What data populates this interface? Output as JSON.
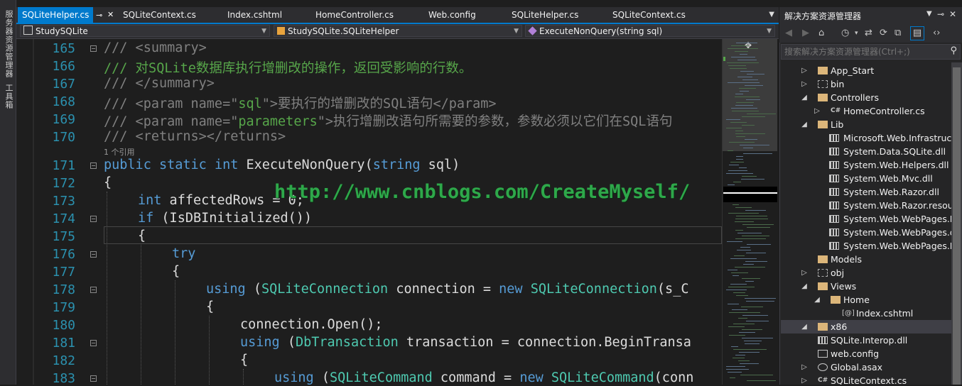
{
  "side_strip": {
    "server_explorer": "服务器资源管理器",
    "toolbox": "工具箱"
  },
  "tabs": [
    {
      "label": "SQLiteHelper.cs",
      "active": true
    },
    {
      "label": "SQLiteContext.cs"
    },
    {
      "label": "Index.cshtml"
    },
    {
      "label": "HomeController.cs"
    },
    {
      "label": "Web.config"
    },
    {
      "label": "SQLiteHelper.cs"
    },
    {
      "label": "SQLiteContext.cs"
    }
  ],
  "nav": {
    "project": "StudySQLite",
    "class": "StudySQLite.SQLiteHelper",
    "member": "ExecuteNonQuery(string sql)"
  },
  "editor": {
    "line_numbers": [
      "165",
      "166",
      "167",
      "168",
      "169",
      "170",
      "171",
      "172",
      "173",
      "174",
      "175",
      "176",
      "177",
      "178",
      "179",
      "180",
      "181",
      "182",
      "183"
    ],
    "codelens": "1 个引用",
    "watermark": "http://www.cnblogs.com/CreateMyself/",
    "lines": {
      "l165": [
        "/// <summary>"
      ],
      "l166": [
        "/// 对SQLite数据库执行增删改的操作，返回受影响的行数。"
      ],
      "l167": [
        "/// </summary>"
      ],
      "l168": [
        "/// <param name=\"",
        "sql",
        "\">要执行的增删改的SQL语句</param>"
      ],
      "l169": [
        "/// <param name=\"",
        "parameters",
        "\">执行增删改语句所需要的参数，参数必须以它们在SQL语句"
      ],
      "l170": [
        "/// <returns></returns>"
      ],
      "l171": [
        "public",
        " ",
        "static",
        " ",
        "int",
        " ExecuteNonQuery(",
        "string",
        " sql)"
      ],
      "l172": [
        "{"
      ],
      "l173": [
        "int",
        " affectedRows = 0;"
      ],
      "l174": [
        "if",
        " (IsDBInitialized())"
      ],
      "l175": [
        "{"
      ],
      "l176": [
        "try"
      ],
      "l177": [
        "{"
      ],
      "l178": [
        "using",
        " (",
        "SQLiteConnection",
        " connection = ",
        "new",
        " ",
        "SQLiteConnection",
        "(s_C"
      ],
      "l179": [
        "{"
      ],
      "l180": [
        "connection.Open();"
      ],
      "l181": [
        "using",
        " (",
        "DbTransaction",
        " transaction = connection.BeginTransa"
      ],
      "l182": [
        "{"
      ],
      "l183": [
        "using",
        " (",
        "SQLiteCommand",
        " command = ",
        "new",
        " ",
        "SQLiteCommand",
        "(conn"
      ]
    }
  },
  "solution_explorer": {
    "title": "解决方案资源管理器",
    "search_placeholder": "搜索解决方案资源管理器(Ctrl+;)",
    "items": [
      {
        "label": "App_Start"
      },
      {
        "label": "bin"
      },
      {
        "label": "Controllers"
      },
      {
        "label": "HomeController.cs"
      },
      {
        "label": "Lib"
      },
      {
        "label": "Microsoft.Web.Infrastructu"
      },
      {
        "label": "System.Data.SQLite.dll"
      },
      {
        "label": "System.Web.Helpers.dll"
      },
      {
        "label": "System.Web.Mvc.dll"
      },
      {
        "label": "System.Web.Razor.dll"
      },
      {
        "label": "System.Web.Razor.resourc"
      },
      {
        "label": "System.Web.WebPages.De"
      },
      {
        "label": "System.Web.WebPages.dl"
      },
      {
        "label": "System.Web.WebPages.Ra"
      },
      {
        "label": "Models"
      },
      {
        "label": "obj"
      },
      {
        "label": "Views"
      },
      {
        "label": "Home"
      },
      {
        "label": "Index.cshtml"
      },
      {
        "label": "x86",
        "selected": true
      },
      {
        "label": "SQLite.Interop.dll"
      },
      {
        "label": "web.config"
      },
      {
        "label": "Global.asax"
      },
      {
        "label": "SQLiteContext.cs"
      }
    ]
  },
  "colors": {
    "accent": "#007acc",
    "comment": "#57a64a",
    "keyword": "#569cd6",
    "type": "#4ec9b0",
    "watermark": "#2ea84a"
  }
}
